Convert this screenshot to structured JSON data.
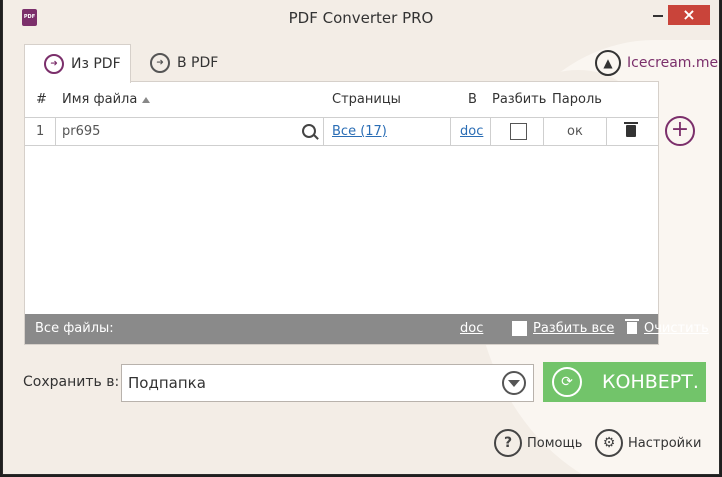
{
  "window": {
    "title": "PDF Converter PRO",
    "app_icon_text": "PDF",
    "close_symbol": "×"
  },
  "tabs": [
    {
      "label": "Из PDF",
      "icon": "from-pdf-icon",
      "active": true
    },
    {
      "label": "В PDF",
      "icon": "to-pdf-icon",
      "active": false
    }
  ],
  "brand": {
    "label": "Icecream.me",
    "icon": "icecream-logo-icon"
  },
  "table": {
    "headers": {
      "num": "#",
      "name": "Имя файла",
      "pages": "Страницы",
      "format": "В",
      "split": "Разбить",
      "password": "Пароль"
    },
    "rows": [
      {
        "num": "1",
        "name": "pr695",
        "pages": "Все (17)",
        "format": "doc",
        "split_checked": false,
        "password": "ок"
      }
    ]
  },
  "footer": {
    "label": "Все файлы:",
    "format": "doc",
    "split_all": "Разбить все",
    "clear": "Очистить"
  },
  "add_symbol": "+",
  "save": {
    "label": "Сохранить в:",
    "value": "Подпапка"
  },
  "convert": {
    "label": "КОНВЕРТ.",
    "icon_symbol": "⟳"
  },
  "help": {
    "label": "Помощь",
    "icon_symbol": "?"
  },
  "settings": {
    "label": "Настройки",
    "icon_symbol": "⚙"
  },
  "colors": {
    "accent": "#7b2f6b",
    "convert_green": "#72c46a",
    "close_red": "#c9443a",
    "link_blue": "#2a6db5"
  }
}
